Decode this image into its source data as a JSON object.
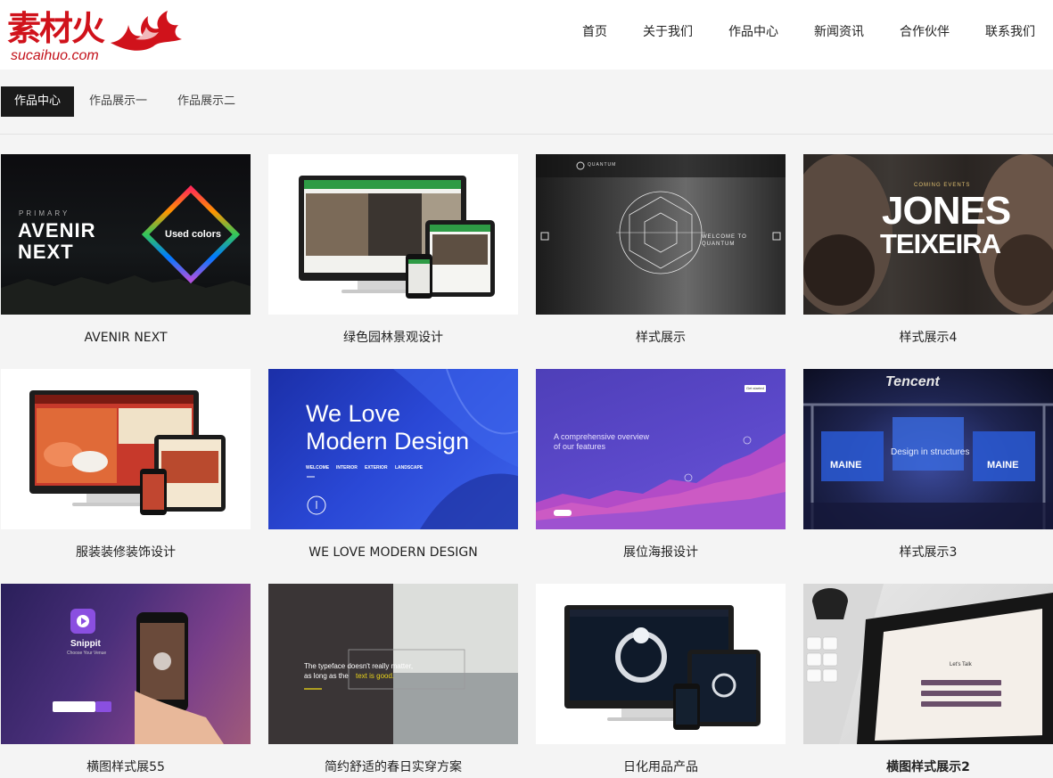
{
  "logo": {
    "brand_cn": "素材火",
    "brand_en": "sucaihuo.com"
  },
  "nav": {
    "items": [
      "首页",
      "关于我们",
      "作品中心",
      "新闻资讯",
      "合作伙伴",
      "联系我们"
    ]
  },
  "tabs": {
    "items": [
      "作品中心",
      "作品展示一",
      "作品展示二"
    ],
    "active": "作品中心"
  },
  "colors": {
    "brand_red": "#d0121b",
    "tab_active_bg": "#1a1a1a",
    "page_bg": "#f4f4f4"
  },
  "works": [
    {
      "caption": "AVENIR NEXT",
      "thumb_text": {
        "small": "PRIMARY",
        "title1": "AVENIR",
        "title2": "NEXT",
        "badge": "Used colors"
      }
    },
    {
      "caption": "绿色园林景观设计"
    },
    {
      "caption": "样式展示",
      "thumb_text": {
        "brand": "QUANTUM",
        "line1": "WELCOME TO",
        "line2": "QUANTUM"
      }
    },
    {
      "caption": "样式展示4",
      "thumb_text": {
        "top": "COMING EVENTS",
        "name1": "JONES",
        "name2": "TEIXEIRA"
      }
    },
    {
      "caption": "服装装修装饰设计"
    },
    {
      "caption": "WE LOVE MODERN DESIGN",
      "thumb_text": {
        "line1": "We Love",
        "line2": "Modern Design",
        "menu": [
          "WELCOME",
          "INTERIOR",
          "EXTERIOR",
          "LANDSCAPE"
        ]
      }
    },
    {
      "caption": "展位海报设计",
      "thumb_text": {
        "line1": "A comprehensive overview",
        "line2": "of our features",
        "button": "Get started"
      }
    },
    {
      "caption": "样式展示3",
      "thumb_text": {
        "brand": "Tencent",
        "sub": "Design in structures",
        "screen1": "MAINE",
        "screen2": "MAINE"
      }
    },
    {
      "caption": "横图样式展55",
      "thumb_text": {
        "app": "Snippit",
        "tagline": "Choose Your Venue"
      }
    },
    {
      "caption": "简约舒适的春日实穿方案",
      "thumb_text": {
        "line1": "The typeface doesn't really matter,",
        "line2_a": "as long as the ",
        "line2_b": "text is good."
      }
    },
    {
      "caption": "日化用品产品"
    },
    {
      "caption": "横图样式展示2",
      "thumb_text": {
        "screen": "Let's Talk"
      }
    }
  ]
}
